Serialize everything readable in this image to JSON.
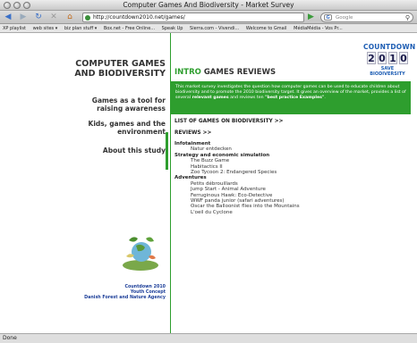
{
  "window": {
    "title": "Computer Games And Biodiversity - Market Survey"
  },
  "toolbar": {
    "back": "◀",
    "forward": "▶",
    "reload": "↻",
    "stop": "✕",
    "home": "⌂",
    "url": "http://countdown2010.net/games/",
    "go": "▶",
    "search_placeholder": "Google",
    "search_engine": "G",
    "search_icon": "⚲"
  },
  "bookmarks": [
    "XP playlist",
    "web sites ▾",
    "biz plan stuff ▾",
    "Box.net - Free Online...",
    "Speak Up",
    "Sierra.com - Vivendi...",
    "Welcome to Gmail",
    "MédiaMédia - Vos Pr..."
  ],
  "sidebar": {
    "title_line1": "COMPUTER GAMES",
    "title_line2": "AND BIODIVERSITY",
    "nav": [
      {
        "line1": "Games as a tool for",
        "line2": "raising awareness"
      },
      {
        "line1": "Kids, games and the",
        "line2": "environment"
      },
      {
        "line1": "About this study",
        "line2": ""
      }
    ],
    "footer": [
      "Countdown 2010",
      "Youth Concept",
      "Danish Forest and Nature Agency"
    ]
  },
  "logo": {
    "top": "COUNTDOWN",
    "digits": [
      "2",
      "0",
      "1",
      "0"
    ],
    "bottom": "SAVE BIODIVERSITY"
  },
  "main": {
    "heading_intro": "INTRO",
    "heading_rest": " GAMES REVIEWS",
    "intro_text_1": "This market survey investigates the question how computer games can be used to educate children about biodiversity and to promote the 2010 biodiversity target. It gives an overview of the market, provides a list of several ",
    "intro_strong_1": "relevant games",
    "intro_text_2": " and reviews ten ",
    "intro_strong_2": "\"best practice Examples\"",
    "intro_text_3": ".",
    "list_link": "LIST OF GAMES ON BIODIVERSITY >>",
    "reviews_link": "REVIEWS >>",
    "categories": [
      {
        "name": "Infotainment",
        "games": [
          "Natur entdecken"
        ]
      },
      {
        "name": "Strategy and economic simulation",
        "games": [
          "The Buzz Game",
          "Habitactics II",
          "Zoo Tycoon 2: Endangered Species"
        ]
      },
      {
        "name": "Adventures",
        "games": [
          "Petits débrouillards",
          "Jump Start - Animal Adventure",
          "Ferruginous Hawk: Eco-Detective",
          "WWF panda junior (safari adventures)",
          "Oscar the Balloonist flies into the Mountains",
          "L'oeil du Cyclone"
        ]
      }
    ]
  },
  "status": {
    "text": "Done"
  },
  "colors": {
    "accent_green": "#2e9e2e",
    "logo_blue": "#1d5db3"
  }
}
